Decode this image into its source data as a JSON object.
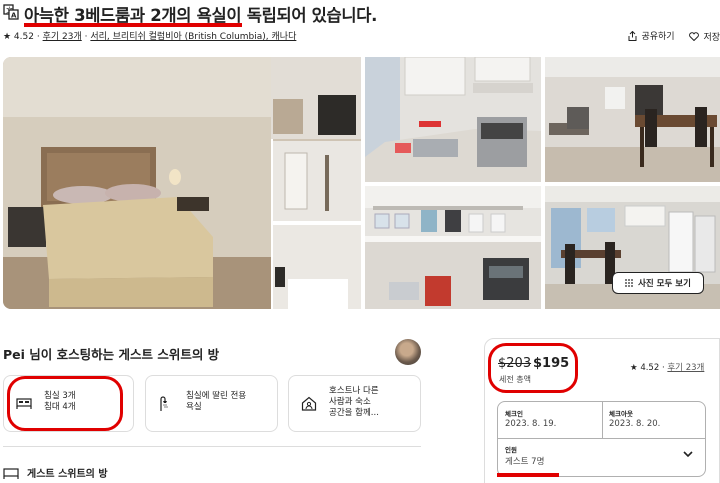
{
  "header": {
    "title": "아늑한 3베드룸과 2개의 욕실이 독립되어 있습니다.",
    "rating": "★ 4.52",
    "dot": "·",
    "reviews": "후기 23개",
    "location": "서리, 브리티쉬 컬럼비아 (British Columbia), 캐나다",
    "share_label": "공유하기",
    "save_label": "저장"
  },
  "photos": {
    "show_all_label": "사진 모두 보기"
  },
  "host": {
    "title": "Pei 님이 호스팅하는 게스트 스위트의 방"
  },
  "features": [
    {
      "icon": "bed-icon",
      "line1": "침실 3개",
      "line2": "침대 4개"
    },
    {
      "icon": "shower-icon",
      "line1": "침실에 딸린 전용",
      "line2": "욕실"
    },
    {
      "icon": "home-icon",
      "line1": "호스트나 다른",
      "line2": "사람과 숙소",
      "line3": "공간을 함께..."
    }
  ],
  "section": {
    "heading": "게스트 스위트의 방"
  },
  "booking": {
    "old_price": "$203",
    "new_price": "$195",
    "price_note": "세전 총액",
    "rating": "★ 4.52",
    "dot": "·",
    "reviews": "후기 23개",
    "checkin_label": "체크인",
    "checkin_value": "2023. 8. 19.",
    "checkout_label": "체크아웃",
    "checkout_value": "2023. 8. 20.",
    "guests_label": "인원",
    "guests_value": "게스트 7명"
  },
  "colors": {
    "annotation_red": "#e00000",
    "border": "#dddddd"
  }
}
